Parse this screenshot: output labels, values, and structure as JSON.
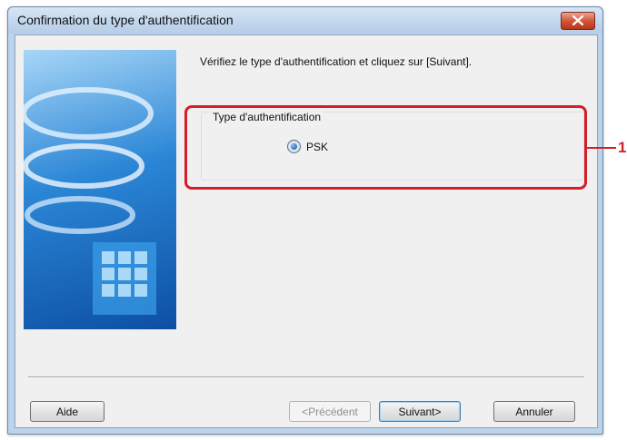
{
  "window": {
    "title": "Confirmation du type d'authentification"
  },
  "main": {
    "instruction": "Vérifiez le type d'authentification et cliquez sur [Suivant].",
    "auth_group": {
      "legend": "Type d'authentification",
      "option_label": "PSK",
      "selected": true
    }
  },
  "annotation": {
    "callout_number": "1",
    "color": "#d41e28"
  },
  "buttons": {
    "help": "Aide",
    "previous": "<Précédent",
    "next": "Suivant>",
    "cancel": "Annuler"
  },
  "icons": {
    "close": "close-icon",
    "illustration": "network-art-image"
  }
}
